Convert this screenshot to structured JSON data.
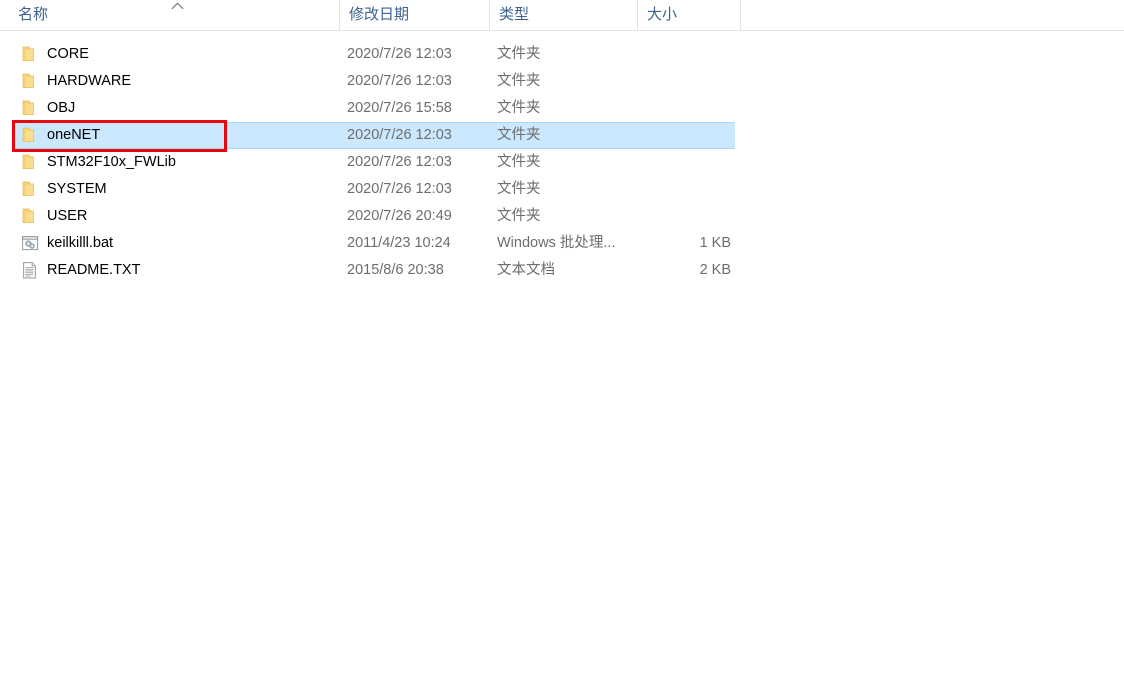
{
  "window": {
    "view_mode": "details"
  },
  "columns": {
    "name": "名称",
    "date_modified": "修改日期",
    "type": "类型",
    "size": "大小",
    "sort_column": "名称",
    "sort_direction": "ascending",
    "sort_icon": "caret-up-icon"
  },
  "colors": {
    "selection_fill": "#cce8ff",
    "selection_border": "#a8d8f8",
    "annotation": "#e8070c",
    "header_text": "#3d6291",
    "folder_icon": "#fbd977",
    "secondary_text": "#6d6d6d"
  },
  "annotation": {
    "shape": "rectangle",
    "target_row": "oneNET",
    "color": "#e8070c"
  },
  "files": [
    {
      "name": "CORE",
      "date_modified": "2020/7/26 12:03",
      "type": "文件夹",
      "size": "",
      "icon": "folder-icon",
      "selected": false
    },
    {
      "name": "HARDWARE",
      "date_modified": "2020/7/26 12:03",
      "type": "文件夹",
      "size": "",
      "icon": "folder-icon",
      "selected": false
    },
    {
      "name": "OBJ",
      "date_modified": "2020/7/26 15:58",
      "type": "文件夹",
      "size": "",
      "icon": "folder-icon",
      "selected": false
    },
    {
      "name": "oneNET",
      "date_modified": "2020/7/26 12:03",
      "type": "文件夹",
      "size": "",
      "icon": "folder-icon",
      "selected": true
    },
    {
      "name": "STM32F10x_FWLib",
      "date_modified": "2020/7/26 12:03",
      "type": "文件夹",
      "size": "",
      "icon": "folder-icon",
      "selected": false
    },
    {
      "name": "SYSTEM",
      "date_modified": "2020/7/26 12:03",
      "type": "文件夹",
      "size": "",
      "icon": "folder-icon",
      "selected": false
    },
    {
      "name": "USER",
      "date_modified": "2020/7/26 20:49",
      "type": "文件夹",
      "size": "",
      "icon": "folder-icon",
      "selected": false
    },
    {
      "name": "keilkilll.bat",
      "date_modified": "2011/4/23 10:24",
      "type": "Windows 批处理...",
      "size": "1 KB",
      "icon": "batch-file-icon",
      "selected": false
    },
    {
      "name": "README.TXT",
      "date_modified": "2015/8/6 20:38",
      "type": "文本文档",
      "size": "2 KB",
      "icon": "text-document-icon",
      "selected": false
    }
  ]
}
